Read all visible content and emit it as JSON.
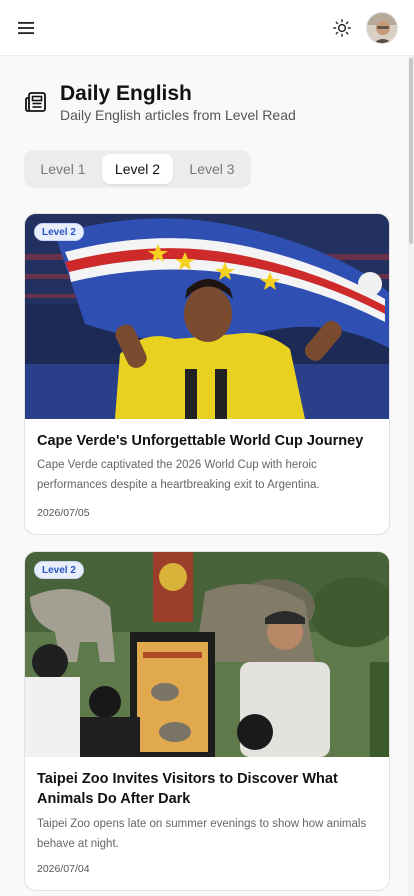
{
  "header": {
    "menu_icon": "hamburger-menu-icon",
    "theme_icon": "sun-icon",
    "avatar_icon": "user-avatar"
  },
  "page": {
    "title": "Daily English",
    "subtitle": "Daily English articles from Level Read",
    "icon": "newspaper-icon"
  },
  "tabs": [
    {
      "label": "Level 1",
      "active": false
    },
    {
      "label": "Level 2",
      "active": true
    },
    {
      "label": "Level 3",
      "active": false
    }
  ],
  "articles": [
    {
      "badge": "Level 2",
      "title": "Cape Verde's Unforgettable World Cup Journey",
      "description": "Cape Verde captivated the 2026 World Cup with heroic performances despite a heartbreaking exit to Argentina.",
      "date": "2026/07/05"
    },
    {
      "badge": "Level 2",
      "title": "Taipei Zoo Invites Visitors to Discover What Animals Do After Dark",
      "description": "Taipei Zoo opens late on summer evenings to show how animals behave at night.",
      "date": "2026/07/04"
    }
  ],
  "colors": {
    "badge_text": "#2a55c0",
    "badge_bg": "#e8eefc",
    "active_tab_bg": "#ffffff",
    "tab_track": "#ececec"
  }
}
